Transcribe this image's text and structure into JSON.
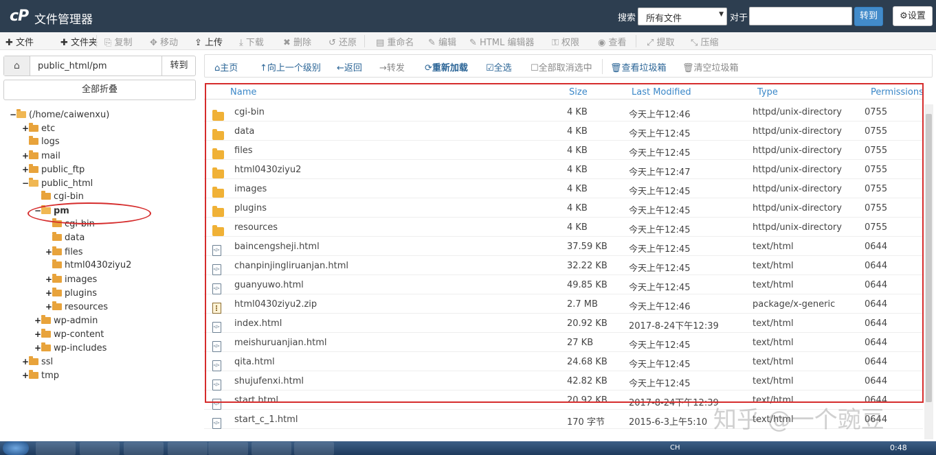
{
  "topbar": {
    "logo": "cP",
    "title": "文件管理器",
    "search_label": "搜索",
    "search_scope": "所有文件",
    "for_label": "对于",
    "search_value": "",
    "go_label": "转到",
    "settings_label": "设置"
  },
  "toolbar": [
    {
      "label": "文件",
      "icon": "plus-icon",
      "enabled": true
    },
    {
      "label": "文件夹",
      "icon": "plus-icon",
      "enabled": true
    },
    {
      "label": "复制",
      "icon": "copy-icon",
      "enabled": false
    },
    {
      "label": "移动",
      "icon": "move-icon",
      "enabled": false
    },
    {
      "label": "上传",
      "icon": "upload-icon",
      "enabled": true
    },
    {
      "label": "下载",
      "icon": "download-icon",
      "enabled": false
    },
    {
      "label": "删除",
      "icon": "delete-icon",
      "enabled": false
    },
    {
      "label": "还原",
      "icon": "restore-icon",
      "enabled": false
    },
    {
      "label": "重命名",
      "icon": "rename-icon",
      "enabled": false
    },
    {
      "label": "编辑",
      "icon": "edit-icon",
      "enabled": false
    },
    {
      "label": "HTML 编辑器",
      "icon": "html-editor-icon",
      "enabled": false
    },
    {
      "label": "权限",
      "icon": "key-icon",
      "enabled": false
    },
    {
      "label": "查看",
      "icon": "eye-icon",
      "enabled": false
    },
    {
      "label": "提取",
      "icon": "extract-icon",
      "enabled": false
    },
    {
      "label": "压缩",
      "icon": "compress-icon",
      "enabled": false
    }
  ],
  "left": {
    "path_value": "public_html/pm",
    "go_label": "转到",
    "collapse_label": "全部折叠",
    "tree": [
      {
        "label": "(/home/caiwenxu)",
        "toggle": "−"
      },
      {
        "label": "etc",
        "toggle": "+"
      },
      {
        "label": "logs",
        "toggle": ""
      },
      {
        "label": "mail",
        "toggle": "+"
      },
      {
        "label": "public_ftp",
        "toggle": "+"
      },
      {
        "label": "public_html",
        "toggle": "−"
      },
      {
        "label": "cgi-bin",
        "toggle": ""
      },
      {
        "label": "pm",
        "toggle": "−"
      },
      {
        "label": "cgi-bin",
        "toggle": ""
      },
      {
        "label": "data",
        "toggle": ""
      },
      {
        "label": "files",
        "toggle": "+"
      },
      {
        "label": "html0430ziyu2",
        "toggle": ""
      },
      {
        "label": "images",
        "toggle": "+"
      },
      {
        "label": "plugins",
        "toggle": "+"
      },
      {
        "label": "resources",
        "toggle": "+"
      },
      {
        "label": "wp-admin",
        "toggle": "+"
      },
      {
        "label": "wp-content",
        "toggle": "+"
      },
      {
        "label": "wp-includes",
        "toggle": "+"
      },
      {
        "label": "ssl",
        "toggle": "+"
      },
      {
        "label": "tmp",
        "toggle": "+"
      }
    ]
  },
  "nav": [
    {
      "label": "主页",
      "icon": "home-icon",
      "enabled": true
    },
    {
      "label": "向上一个级别",
      "icon": "level-up-icon",
      "enabled": true
    },
    {
      "label": "返回",
      "icon": "back-arrow-icon",
      "enabled": true
    },
    {
      "label": "转发",
      "icon": "forward-arrow-icon",
      "enabled": false
    },
    {
      "label": "重新加载",
      "icon": "reload-icon",
      "enabled": true
    },
    {
      "label": "全选",
      "icon": "checkbox-checked-icon",
      "enabled": true
    },
    {
      "label": "全部取消选中",
      "icon": "checkbox-empty-icon",
      "enabled": false
    },
    {
      "label": "查看垃圾箱",
      "icon": "trash-icon",
      "enabled": true
    },
    {
      "label": "清空垃圾箱",
      "icon": "trash-icon",
      "enabled": false
    }
  ],
  "table": {
    "headers": {
      "name": "Name",
      "size": "Size",
      "modified": "Last Modified",
      "type": "Type",
      "perms": "Permissions"
    },
    "rows": [
      {
        "icon": "folder-icon",
        "name": "cgi-bin",
        "size": "4 KB",
        "modified": "今天上午12:46",
        "type": "httpd/unix-directory",
        "perms": "0755"
      },
      {
        "icon": "folder-icon",
        "name": "data",
        "size": "4 KB",
        "modified": "今天上午12:45",
        "type": "httpd/unix-directory",
        "perms": "0755"
      },
      {
        "icon": "folder-icon",
        "name": "files",
        "size": "4 KB",
        "modified": "今天上午12:45",
        "type": "httpd/unix-directory",
        "perms": "0755"
      },
      {
        "icon": "folder-icon",
        "name": "html0430ziyu2",
        "size": "4 KB",
        "modified": "今天上午12:47",
        "type": "httpd/unix-directory",
        "perms": "0755"
      },
      {
        "icon": "folder-icon",
        "name": "images",
        "size": "4 KB",
        "modified": "今天上午12:45",
        "type": "httpd/unix-directory",
        "perms": "0755"
      },
      {
        "icon": "folder-icon",
        "name": "plugins",
        "size": "4 KB",
        "modified": "今天上午12:45",
        "type": "httpd/unix-directory",
        "perms": "0755"
      },
      {
        "icon": "folder-icon",
        "name": "resources",
        "size": "4 KB",
        "modified": "今天上午12:45",
        "type": "httpd/unix-directory",
        "perms": "0755"
      },
      {
        "icon": "html-file-icon",
        "name": "baincengsheji.html",
        "size": "37.59 KB",
        "modified": "今天上午12:45",
        "type": "text/html",
        "perms": "0644"
      },
      {
        "icon": "html-file-icon",
        "name": "chanpinjingliruanjan.html",
        "size": "32.22 KB",
        "modified": "今天上午12:45",
        "type": "text/html",
        "perms": "0644"
      },
      {
        "icon": "html-file-icon",
        "name": "guanyuwo.html",
        "size": "49.85 KB",
        "modified": "今天上午12:45",
        "type": "text/html",
        "perms": "0644"
      },
      {
        "icon": "zip-file-icon",
        "name": "html0430ziyu2.zip",
        "size": "2.7 MB",
        "modified": "今天上午12:46",
        "type": "package/x-generic",
        "perms": "0644"
      },
      {
        "icon": "html-file-icon",
        "name": "index.html",
        "size": "20.92 KB",
        "modified": "2017-8-24下午12:39",
        "type": "text/html",
        "perms": "0644"
      },
      {
        "icon": "html-file-icon",
        "name": "meishuruanjian.html",
        "size": "27 KB",
        "modified": "今天上午12:45",
        "type": "text/html",
        "perms": "0644"
      },
      {
        "icon": "html-file-icon",
        "name": "qita.html",
        "size": "24.68 KB",
        "modified": "今天上午12:45",
        "type": "text/html",
        "perms": "0644"
      },
      {
        "icon": "html-file-icon",
        "name": "shujufenxi.html",
        "size": "42.82 KB",
        "modified": "今天上午12:45",
        "type": "text/html",
        "perms": "0644"
      },
      {
        "icon": "html-file-icon",
        "name": "start.html",
        "size": "20.92 KB",
        "modified": "2017-8-24下午12:39",
        "type": "text/html",
        "perms": "0644"
      },
      {
        "icon": "html-file-icon",
        "name": "start_c_1.html",
        "size": "170 字节",
        "modified": "2015-6-3上午5:10",
        "type": "text/html",
        "perms": "0644"
      }
    ]
  },
  "watermark": "知乎 @一个豌豆",
  "taskbar": {
    "clock": "0:48",
    "tray_lang": "CH"
  },
  "colors": {
    "navbar": "#2d3e50",
    "accent": "#428bca",
    "annotation": "#d52b2b",
    "folder": "#f0b136"
  }
}
